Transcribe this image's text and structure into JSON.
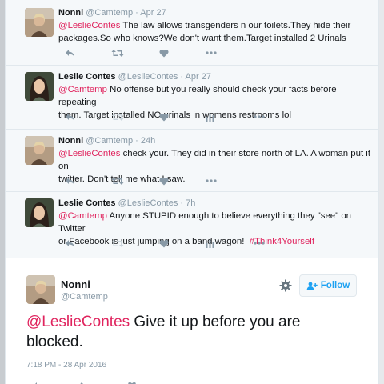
{
  "tweets": [
    {
      "name": "Nonni",
      "handle": "@Camtemp",
      "time": "Apr 27",
      "mention": "@LeslieContes",
      "text_line1_rest": " The law allows transgenders n our toilets.They hide their",
      "text_line2": "packages.So who knows?We don't want them.Target installed 2 Urinals"
    },
    {
      "name": "Leslie Contes",
      "handle": "@LeslieContes",
      "time": "Apr 27",
      "mention": "@Camtemp",
      "text_line1_rest": " No offense but you really should check your facts before repeating",
      "text_line2": "them. Target installed NO urinals in womens restrooms lol"
    },
    {
      "name": "Nonni",
      "handle": "@Camtemp",
      "time": "24h",
      "mention": "@LeslieContes",
      "text_line1_rest": " check your. They did in their store north of LA. A woman put it on",
      "text_line2": "twitter. Don't tell me what I saw."
    },
    {
      "name": "Leslie Contes",
      "handle": "@LeslieContes",
      "time": "7h",
      "mention": "@Camtemp",
      "text_line1_rest": " Anyone STUPID enough to believe everything they \"see\" on Twitter",
      "text_line2_start": "or Facebook is just jumping on a band wagon!  ",
      "hashtag": "#Think4Yourself"
    }
  ],
  "main_tweet": {
    "name": "Nonni",
    "handle": "@Camtemp",
    "follow_label": "Follow",
    "mention": "@LeslieContes",
    "text_rest": " Give it up before you are blocked.",
    "date": "7:18 PM - 28 Apr 2016"
  },
  "colors": {
    "mention": "#e0245e",
    "follow": "#1da1f2",
    "muted": "#8899a6"
  },
  "icons": [
    "reply-icon",
    "retweet-icon",
    "like-icon",
    "analytics-icon",
    "more-icon",
    "gear-icon",
    "follow-person-icon"
  ]
}
